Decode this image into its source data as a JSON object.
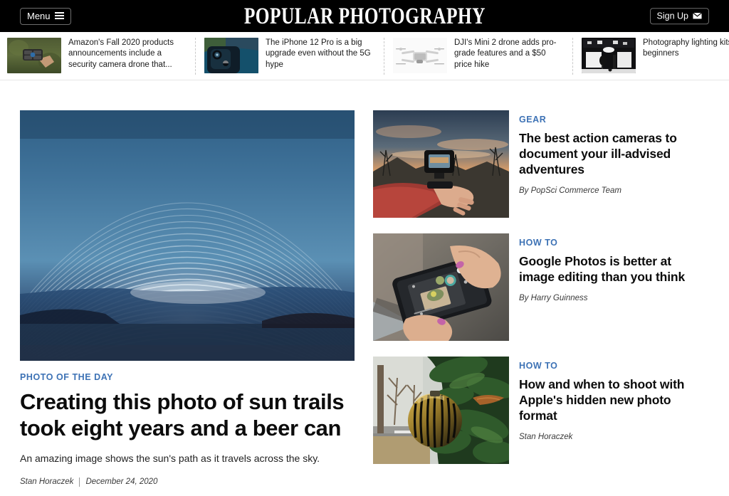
{
  "header": {
    "menu_label": "Menu",
    "menu_icon": "hamburger-icon",
    "brand": "POPULAR  PHOTOGRAPHY",
    "signup_label": "Sign Up",
    "signup_icon": "envelope-icon",
    "background": "#000000"
  },
  "ticker": {
    "items": [
      {
        "title": "Amazon's Fall 2020 products announcements include a security camera drone that...",
        "image": "drone-in-hand-green-field"
      },
      {
        "title": "The iPhone 12 Pro is a big upgrade even without the 5G hype",
        "image": "blue-iphone-12-pro-camera-closeup"
      },
      {
        "title": "DJI's Mini 2 drone adds pro-grade features and a $50 price hike",
        "image": "white-dji-mini-2-drone"
      },
      {
        "title": "Photography lighting kits beginners",
        "image": "photo-studio-lighting-setup"
      }
    ]
  },
  "hero": {
    "kicker": "PHOTO OF THE DAY",
    "headline": "Creating this photo of sun trails took eight years and a beer can",
    "dek": "An amazing image shows the sun's path as it travels across the sky.",
    "author": "Stan Horaczek",
    "date": "December 24, 2020",
    "image": "solargraph-sun-trails-blue-sky"
  },
  "sidebar": {
    "cards": [
      {
        "kicker": "GEAR",
        "title": "The best action cameras to document your ill-advised adventures",
        "byline": "By PopSci Commerce Team",
        "image": "action-camera-on-wrist-at-sunset"
      },
      {
        "kicker": "HOW TO",
        "title": "Google Photos is better at image editing than you think",
        "byline": "By Harry Guinness",
        "image": "hands-holding-smartphone-editing-photo"
      },
      {
        "kicker": "HOW TO",
        "title": "How and when to shoot with Apple's hidden new photo format",
        "byline": "Stan Horaczek",
        "image": "gold-ornament-on-evergreen-branch"
      }
    ]
  },
  "colors": {
    "accent_blue": "#3d72b5",
    "header_black": "#000000",
    "text_dark": "#0c0c0c",
    "divider": "#c9c9c9"
  }
}
